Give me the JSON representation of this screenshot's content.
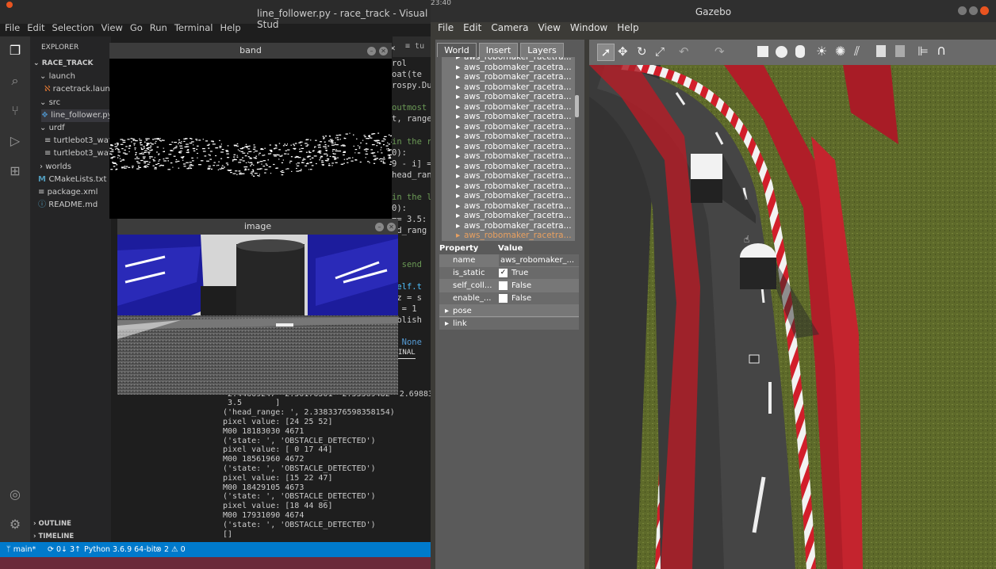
{
  "vscode": {
    "title": "line_follower.py - race_track - Visual Stud",
    "menu": [
      "File",
      "Edit",
      "Selection",
      "View",
      "Go",
      "Run",
      "Terminal",
      "Help"
    ],
    "explorer_label": "EXPLORER",
    "tree": [
      {
        "label": "RACE_TRACK",
        "icon": "chevron-down"
      },
      {
        "label": "launch",
        "icon": "chevron-down"
      },
      {
        "label": "racetrack.launch",
        "icon": "launch-file"
      },
      {
        "label": "src",
        "icon": "chevron-down"
      },
      {
        "label": "line_follower.py",
        "icon": "python-file"
      },
      {
        "label": "urdf",
        "icon": "chevron-down"
      },
      {
        "label": "turtlebot3_waff",
        "icon": "xml-file"
      },
      {
        "label": "turtlebot3_waff",
        "icon": "xml-file"
      },
      {
        "label": "worlds",
        "icon": "chevron-right"
      },
      {
        "label": "CMakeLists.txt",
        "icon": "cmake-file"
      },
      {
        "label": "package.xml",
        "icon": "xml-file"
      },
      {
        "label": "README.md",
        "icon": "info-file"
      }
    ],
    "outline_label": "OUTLINE",
    "timeline_label": "TIMELINE",
    "tab_label": "tu",
    "code_lines": [
      {
        "t": "rol",
        "c": "#ccc"
      },
      {
        "t": "oat(te",
        "c": "#ccc"
      },
      {
        "t": "rospy.Du",
        "c": "#ccc"
      },
      {
        "t": "",
        "c": "#ccc"
      },
      {
        "t": "outmost",
        "c": "#6a9955"
      },
      {
        "t": "t, range",
        "c": "#ccc"
      },
      {
        "t": "",
        "c": "#ccc"
      },
      {
        "t": "in the r",
        "c": "#6a9955"
      },
      {
        "t": "0):",
        "c": "#ccc"
      },
      {
        "t": "9 - i] =",
        "c": "#ccc"
      },
      {
        "t": "head_range",
        "c": "#ccc"
      },
      {
        "t": "",
        "c": "#ccc"
      },
      {
        "t": "in the l",
        "c": "#6a9955"
      },
      {
        "t": "0):",
        "c": "#ccc"
      },
      {
        "t": "== 3.5:",
        "c": "#ccc"
      },
      {
        "t": "ad_rang",
        "c": "#ccc"
      },
      {
        "t": "",
        "c": "#ccc"
      },
      {
        "t": "",
        "c": "#ccc"
      },
      {
        "t": "y send",
        "c": "#6a9955"
      },
      {
        "t": "",
        "c": "#ccc"
      },
      {
        "t": "self.t",
        "c": "#4fc1ff"
      },
      {
        "t": ".z = s",
        "c": "#ccc"
      },
      {
        "t": "x = 1",
        "c": "#ccc"
      },
      {
        "t": "ublish",
        "c": "#ccc"
      },
      {
        "t": "",
        "c": "#ccc"
      },
      {
        "t": "= None",
        "c": "#569cd6"
      }
    ],
    "terminal_tab": "INAL",
    "terminal_lines": [
      "                         2.33837",
      "                         2.38996",
      " 2.44669247  2.50176501  2.55569482  2.69883",
      " 3.5       ]",
      "('head_range: ', 2.3383376598358154)",
      "pixel value: [24 25 52]",
      "M00 18183030 4671",
      "('state: ', 'OBSTACLE_DETECTED')",
      "pixel value: [ 0 17 44]",
      "M00 18561960 4672",
      "('state: ', 'OBSTACLE_DETECTED')",
      "pixel value: [15 22 47]",
      "M00 18429105 4673",
      "('state: ', 'OBSTACLE_DETECTED')",
      "pixel value: [18 44 86]",
      "M00 17931090 4674",
      "('state: ', 'OBSTACLE_DETECTED')",
      "[]"
    ],
    "status": {
      "branch": "main*",
      "sync": "0↓ 3↑",
      "python": "Python 3.6.9 64-bit",
      "problems": "⊗ 2 ⚠ 0"
    }
  },
  "band_window": {
    "title": "band"
  },
  "image_window": {
    "title": "image"
  },
  "gazebo": {
    "title": "Gazebo",
    "top_clock": "23:40",
    "menu": [
      "File",
      "Edit",
      "Camera",
      "View",
      "Window",
      "Help"
    ],
    "tabs": [
      "World",
      "Insert",
      "Layers"
    ],
    "model_item": "aws_robomaker_racetra...",
    "property_header": {
      "property": "Property",
      "value": "Value"
    },
    "properties": [
      {
        "name": "name",
        "value": "aws_robomaker_...",
        "check": null
      },
      {
        "name": "is_static",
        "value": "True",
        "check": true
      },
      {
        "name": "self_coll...",
        "value": "False",
        "check": false
      },
      {
        "name": "enable_...",
        "value": "False",
        "check": false
      }
    ],
    "groups": [
      "pose",
      "link"
    ]
  }
}
